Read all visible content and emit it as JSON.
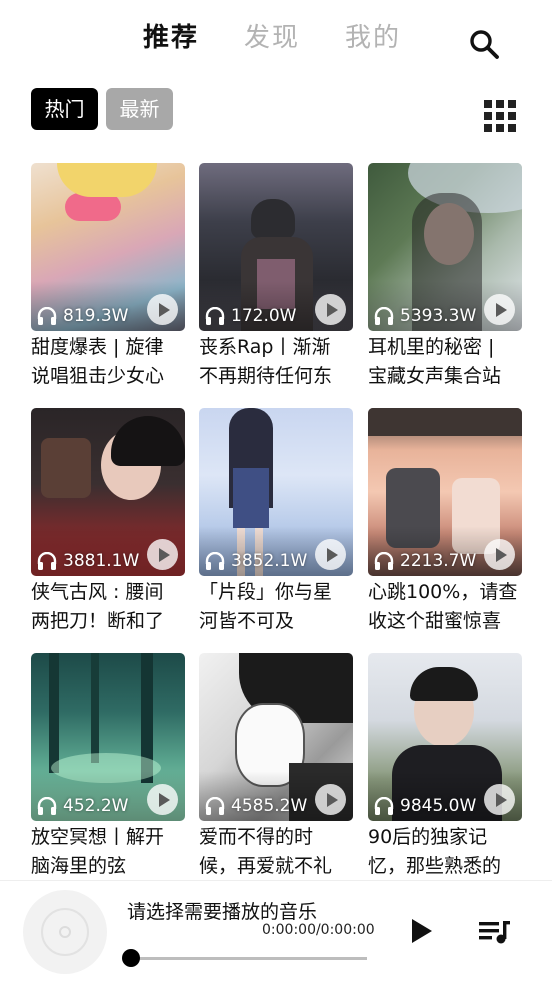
{
  "tabs": [
    "推荐",
    "发现",
    "我的"
  ],
  "filters": [
    "热门",
    "最新"
  ],
  "playlists": [
    {
      "plays": "819.3W",
      "title": "甜度爆表 | 旋律\n说唱狙击少女心"
    },
    {
      "plays": "172.0W",
      "title": "丧系Rap丨渐渐\n不再期待任何东"
    },
    {
      "plays": "5393.3W",
      "title": "耳机里的秘密 |\n宝藏女声集合站"
    },
    {
      "plays": "3881.1W",
      "title": "侠气古风 : 腰间\n两把刀！断和了"
    },
    {
      "plays": "3852.1W",
      "title": "「片段」你与星\n河皆不可及"
    },
    {
      "plays": "2213.7W",
      "title": "心跳100%，请查\n收这个甜蜜惊喜"
    },
    {
      "plays": "452.2W",
      "title": "放空冥想丨解开\n脑海里的弦"
    },
    {
      "plays": "4585.2W",
      "title": "爱而不得的时\n候，再爱就不礼"
    },
    {
      "plays": "9845.0W",
      "title": "90后的独家记\n忆，那些熟悉的"
    }
  ],
  "player": {
    "now_playing": "请选择需要播放的音乐",
    "time": "0:00:00/0:00:00",
    "progress": 0
  },
  "icons": {
    "search": "search-icon",
    "grid": "grid-icon",
    "headphones": "headphones-icon",
    "play": "play-icon",
    "queue": "playlist-queue-icon",
    "disc": "disc-icon"
  }
}
